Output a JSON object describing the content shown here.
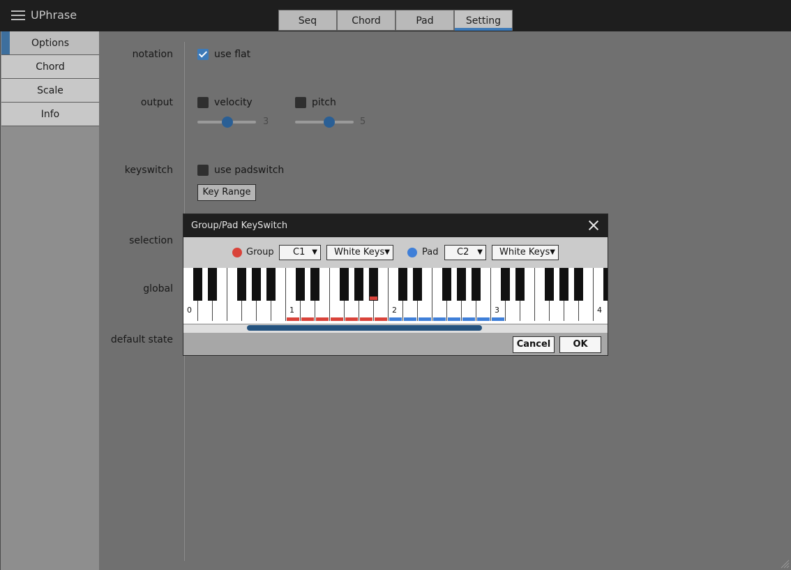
{
  "app": {
    "title": "UPhrase"
  },
  "tabs": [
    {
      "label": "Seq"
    },
    {
      "label": "Chord"
    },
    {
      "label": "Pad"
    },
    {
      "label": "Setting",
      "active": true
    }
  ],
  "sidebar": {
    "items": [
      {
        "label": "Options",
        "active": true
      },
      {
        "label": "Chord"
      },
      {
        "label": "Scale"
      },
      {
        "label": "Info"
      }
    ]
  },
  "settings": {
    "notation": {
      "label": "notation",
      "use_flat_label": "use flat",
      "use_flat_checked": true
    },
    "output": {
      "label": "output",
      "velocity_label": "velocity",
      "velocity_checked": false,
      "velocity_value": "3",
      "pitch_label": "pitch",
      "pitch_checked": false,
      "pitch_value": "5"
    },
    "keyswitch": {
      "label": "keyswitch",
      "use_padswitch_label": "use padswitch",
      "use_padswitch_checked": false,
      "key_range_button": "Key Range"
    },
    "selection": {
      "label": "selection"
    },
    "global": {
      "label": "global"
    },
    "default_state": {
      "label": "default state"
    }
  },
  "dialog": {
    "title": "Group/Pad KeySwitch",
    "group": {
      "label": "Group",
      "color": "#d9433a",
      "note": "C1",
      "mode": "White Keys"
    },
    "pad": {
      "label": "Pad",
      "color": "#3f7fd8",
      "note": "C2",
      "mode": "White Keys"
    },
    "octave_labels": [
      "0",
      "1",
      "2",
      "3",
      "4"
    ],
    "cancel_label": "Cancel",
    "ok_label": "OK"
  },
  "colors": {
    "accent": "#3d7ab8",
    "header_bg": "#1e1e1e",
    "group": "#d9433a",
    "pad": "#3f7fd8"
  }
}
